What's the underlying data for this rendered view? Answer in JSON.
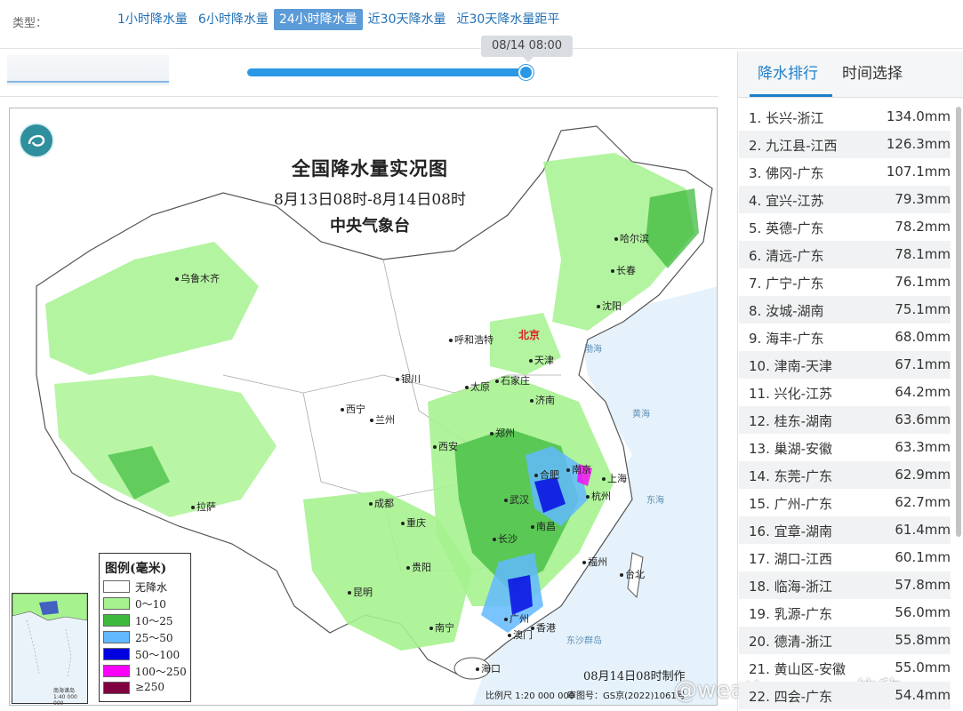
{
  "typebar": {
    "label": "类型：",
    "tabs": [
      {
        "label": "1小时降水量",
        "active": false
      },
      {
        "label": "6小时降水量",
        "active": false
      },
      {
        "label": "24小时降水量",
        "active": true
      },
      {
        "label": "近30天降水量",
        "active": false
      },
      {
        "label": "近30天降水量距平",
        "active": false
      }
    ]
  },
  "slider": {
    "tooltip": "08/14 08:00",
    "progress_percent": 100
  },
  "map": {
    "title": "全国降水量实况图",
    "subtitle": "8月13日08时-8月14日08时",
    "agency": "中央气象台",
    "cities": [
      "乌鲁木齐",
      "哈尔滨",
      "长春",
      "沈阳",
      "呼和浩特",
      "北京",
      "天津",
      "石家庄",
      "太原",
      "银川",
      "西宁",
      "兰州",
      "济南",
      "郑州",
      "西安",
      "合肥",
      "南京",
      "上海",
      "杭州",
      "武汉",
      "成都",
      "重庆",
      "长沙",
      "南昌",
      "拉萨",
      "贵阳",
      "昆明",
      "福州",
      "台北",
      "广州",
      "香港",
      "澳门",
      "南宁",
      "海口"
    ],
    "seas": [
      "渤海",
      "黄海",
      "东海",
      "东沙群岛"
    ],
    "legend": {
      "title": "图例(毫米)",
      "items": [
        {
          "label": "无降水",
          "color": "#ffffff"
        },
        {
          "label": "0～10",
          "color": "#a6f28f"
        },
        {
          "label": "10～25",
          "color": "#3dba3d"
        },
        {
          "label": "25～50",
          "color": "#61b8ff"
        },
        {
          "label": "50～100",
          "color": "#0000e1"
        },
        {
          "label": "100～250",
          "color": "#fa00fa"
        },
        {
          "label": "≥250",
          "color": "#800040"
        }
      ]
    },
    "inset_label": "南海诸岛 1:40 000 000",
    "made_label": "08月14日08时制作",
    "scale_label": "比例尺 1:20 000 000",
    "review_label": "审图号：GS京(2022)1061号"
  },
  "watermark": "@weatherman_信欣",
  "ranking": {
    "tabs": [
      {
        "label": "降水排行",
        "active": true
      },
      {
        "label": "时间选择",
        "active": false
      }
    ],
    "rows": [
      {
        "name": "1. 长兴-浙江",
        "value": "134.0mm"
      },
      {
        "name": "2. 九江县-江西",
        "value": "126.3mm"
      },
      {
        "name": "3. 佛冈-广东",
        "value": "107.1mm"
      },
      {
        "name": "4. 宜兴-江苏",
        "value": "79.3mm"
      },
      {
        "name": "5. 英德-广东",
        "value": "78.2mm"
      },
      {
        "name": "6. 清远-广东",
        "value": "78.1mm"
      },
      {
        "name": "7. 广宁-广东",
        "value": "76.1mm"
      },
      {
        "name": "8. 汝城-湖南",
        "value": "75.1mm"
      },
      {
        "name": "9. 海丰-广东",
        "value": "68.0mm"
      },
      {
        "name": "10. 津南-天津",
        "value": "67.1mm"
      },
      {
        "name": "11. 兴化-江苏",
        "value": "64.2mm"
      },
      {
        "name": "12. 桂东-湖南",
        "value": "63.6mm"
      },
      {
        "name": "13. 巢湖-安徽",
        "value": "63.3mm"
      },
      {
        "name": "14. 东莞-广东",
        "value": "62.9mm"
      },
      {
        "name": "15. 广州-广东",
        "value": "62.7mm"
      },
      {
        "name": "16. 宜章-湖南",
        "value": "61.4mm"
      },
      {
        "name": "17. 湖口-江西",
        "value": "60.1mm"
      },
      {
        "name": "18. 临海-浙江",
        "value": "57.8mm"
      },
      {
        "name": "19. 乳源-广东",
        "value": "56.0mm"
      },
      {
        "name": "20. 德清-浙江",
        "value": "55.8mm"
      },
      {
        "name": "21. 黄山区-安徽",
        "value": "55.0mm"
      },
      {
        "name": "22. 四会-广东",
        "value": "54.4mm"
      }
    ]
  }
}
